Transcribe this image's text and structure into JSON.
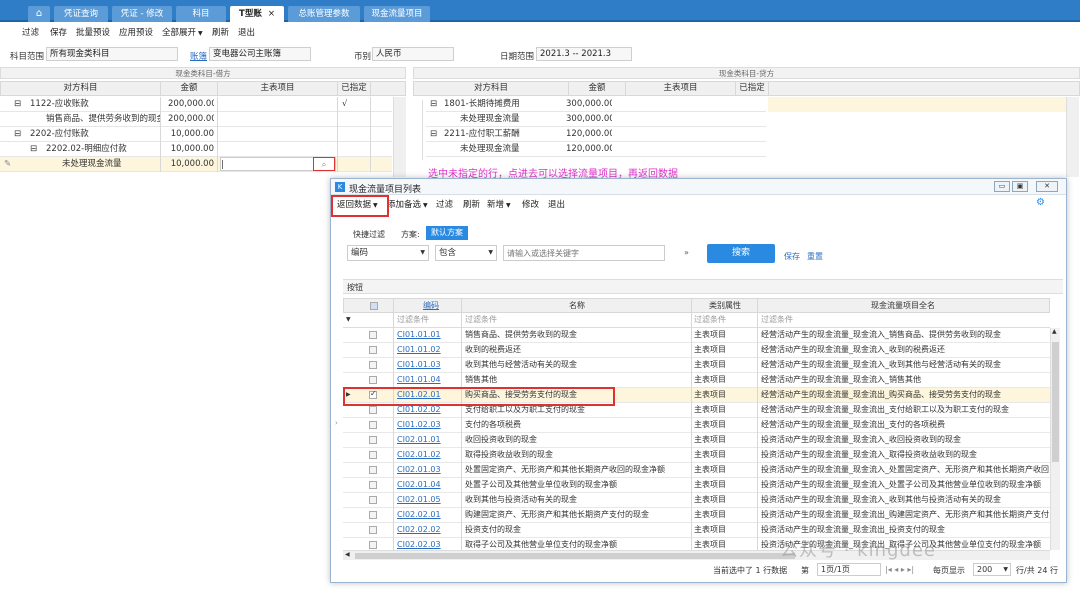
{
  "tabs": [
    {
      "label": "凭证查询"
    },
    {
      "label": "凭证 - 修改"
    },
    {
      "label": "科目"
    },
    {
      "label": "T型账",
      "close": "×"
    },
    {
      "label": "总账管理参数"
    },
    {
      "label": "现金流量项目"
    }
  ],
  "menu": [
    "过滤",
    "保存",
    "批量预设",
    "应用预设",
    "全部展开",
    "刷新",
    "退出"
  ],
  "filters": {
    "subject_range_label": "科目范围",
    "subject_range_value": "所有现金类科目",
    "book_label": "账簿",
    "book_value": "变电器公司主账簿",
    "currency_label": "币别",
    "currency_value": "人民币",
    "date_label": "日期范围",
    "date_value": "2021.3 -- 2021.3"
  },
  "left_panel": {
    "title": "现金类科目-借方",
    "headers": [
      "对方科目",
      "金额",
      "主表项目",
      "已指定"
    ],
    "rows": [
      {
        "tree": "⊟",
        "name": "1122-应收账款",
        "amount": "200,000.00",
        "item": "",
        "flag": "√"
      },
      {
        "tree": "",
        "name": "销售商品、提供劳务收到的现金",
        "amount": "200,000.00",
        "item": "",
        "flag": ""
      },
      {
        "tree": "⊟",
        "name": "2202-应付账款",
        "amount": "10,000.00",
        "item": "",
        "flag": ""
      },
      {
        "tree": "⊟",
        "name": "2202.02-明细应付款",
        "amount": "10,000.00",
        "item": "",
        "flag": ""
      },
      {
        "tree": "",
        "name": "未处理现金流量",
        "amount": "10,000.00",
        "item": "|",
        "flag": ""
      }
    ]
  },
  "right_panel": {
    "title": "现金类科目-贷方",
    "headers": [
      "对方科目",
      "金额",
      "主表项目",
      "已指定"
    ],
    "rows": [
      {
        "tree": "⊟",
        "name": "1801-长期待摊费用",
        "amount": "300,000.00"
      },
      {
        "tree": "",
        "name": "未处理现金流量",
        "amount": "300,000.00"
      },
      {
        "tree": "⊟",
        "name": "2211-应付职工薪酬",
        "amount": "120,000.00"
      },
      {
        "tree": "",
        "name": "未处理现金流量",
        "amount": "120,000.00"
      }
    ]
  },
  "annotation": "选中未指定的行，点进去可以选择流量项目，再返回数据",
  "dialog": {
    "title": "现金流量项目列表",
    "toolbar": [
      "返回数据",
      "添加备选",
      "过滤",
      "刷新",
      "新增",
      "修改",
      "退出"
    ],
    "quick_filter_label": "快捷过滤",
    "scheme_label": "方案:",
    "scheme_value": "默认方案",
    "field_select": "编码",
    "op_select": "包含",
    "search_placeholder": "请输入或选择关键字",
    "search_button": "搜索",
    "save_link": "保存",
    "reset_link": "重置",
    "section_label": "按钮",
    "headers": [
      "编码",
      "名称",
      "类别属性",
      "现金流量项目全名"
    ],
    "filter_row": [
      "过滤条件",
      "过滤条件",
      "过滤条件",
      "过滤条件"
    ],
    "rows": [
      {
        "code": "CI01.01.01",
        "name": "销售商品、提供劳务收到的现金",
        "type": "主表项目",
        "full": "经营活动产生的现金流量_现金流入_销售商品、提供劳务收到的现金",
        "checked": false
      },
      {
        "code": "CI01.01.02",
        "name": "收到的税费返还",
        "type": "主表项目",
        "full": "经营活动产生的现金流量_现金流入_收到的税费返还",
        "checked": false
      },
      {
        "code": "CI01.01.03",
        "name": "收到其他与经营活动有关的现金",
        "type": "主表项目",
        "full": "经营活动产生的现金流量_现金流入_收到其他与经营活动有关的现金",
        "checked": false
      },
      {
        "code": "CI01.01.04",
        "name": "销售其他",
        "type": "主表项目",
        "full": "经营活动产生的现金流量_现金流入_销售其他",
        "checked": false
      },
      {
        "code": "CI01.02.01",
        "name": "购买商品、接受劳务支付的现金",
        "type": "主表项目",
        "full": "经营活动产生的现金流量_现金流出_购买商品、接受劳务支付的现金",
        "checked": true
      },
      {
        "code": "CI01.02.02",
        "name": "支付给职工以及为职工支付的现金",
        "type": "主表项目",
        "full": "经营活动产生的现金流量_现金流出_支付给职工以及为职工支付的现金",
        "checked": false
      },
      {
        "code": "CI01.02.03",
        "name": "支付的各项税费",
        "type": "主表项目",
        "full": "经营活动产生的现金流量_现金流出_支付的各项税费",
        "checked": false
      },
      {
        "code": "CI02.01.01",
        "name": "收回投资收到的现金",
        "type": "主表项目",
        "full": "投资活动产生的现金流量_现金流入_收回投资收到的现金",
        "checked": false
      },
      {
        "code": "CI02.01.02",
        "name": "取得投资收益收到的现金",
        "type": "主表项目",
        "full": "投资活动产生的现金流量_现金流入_取得投资收益收到的现金",
        "checked": false
      },
      {
        "code": "CI02.01.03",
        "name": "处置固定资产、无形资产和其他长期资产收回的现金净额",
        "type": "主表项目",
        "full": "投资活动产生的现金流量_现金流入_处置固定资产、无形资产和其他长期资产收回",
        "checked": false
      },
      {
        "code": "CI02.01.04",
        "name": "处置子公司及其他营业单位收到的现金净额",
        "type": "主表项目",
        "full": "投资活动产生的现金流量_现金流入_处置子公司及其他营业单位收到的现金净额",
        "checked": false
      },
      {
        "code": "CI02.01.05",
        "name": "收到其他与投资活动有关的现金",
        "type": "主表项目",
        "full": "投资活动产生的现金流量_现金流入_收到其他与投资活动有关的现金",
        "checked": false
      },
      {
        "code": "CI02.02.01",
        "name": "购建固定资产、无形资产和其他长期资产支付的现金",
        "type": "主表项目",
        "full": "投资活动产生的现金流量_现金流出_购建固定资产、无形资产和其他长期资产支付",
        "checked": false
      },
      {
        "code": "CI02.02.02",
        "name": "投资支付的现金",
        "type": "主表项目",
        "full": "投资活动产生的现金流量_现金流出_投资支付的现金",
        "checked": false
      },
      {
        "code": "CI02.02.03",
        "name": "取得子公司及其他营业单位支付的现金净额",
        "type": "主表项目",
        "full": "投资活动产生的现金流量_现金流出_取得子公司及其他营业单位支付的现金净额",
        "checked": false
      }
    ],
    "status": "当前选中了 1 行数据",
    "page_label": "第",
    "page_value": "1页/1页",
    "per_page_label": "每页显示",
    "per_page_value": "200",
    "total": "行/共 24 行"
  },
  "watermark": "公众号 · kingdee"
}
